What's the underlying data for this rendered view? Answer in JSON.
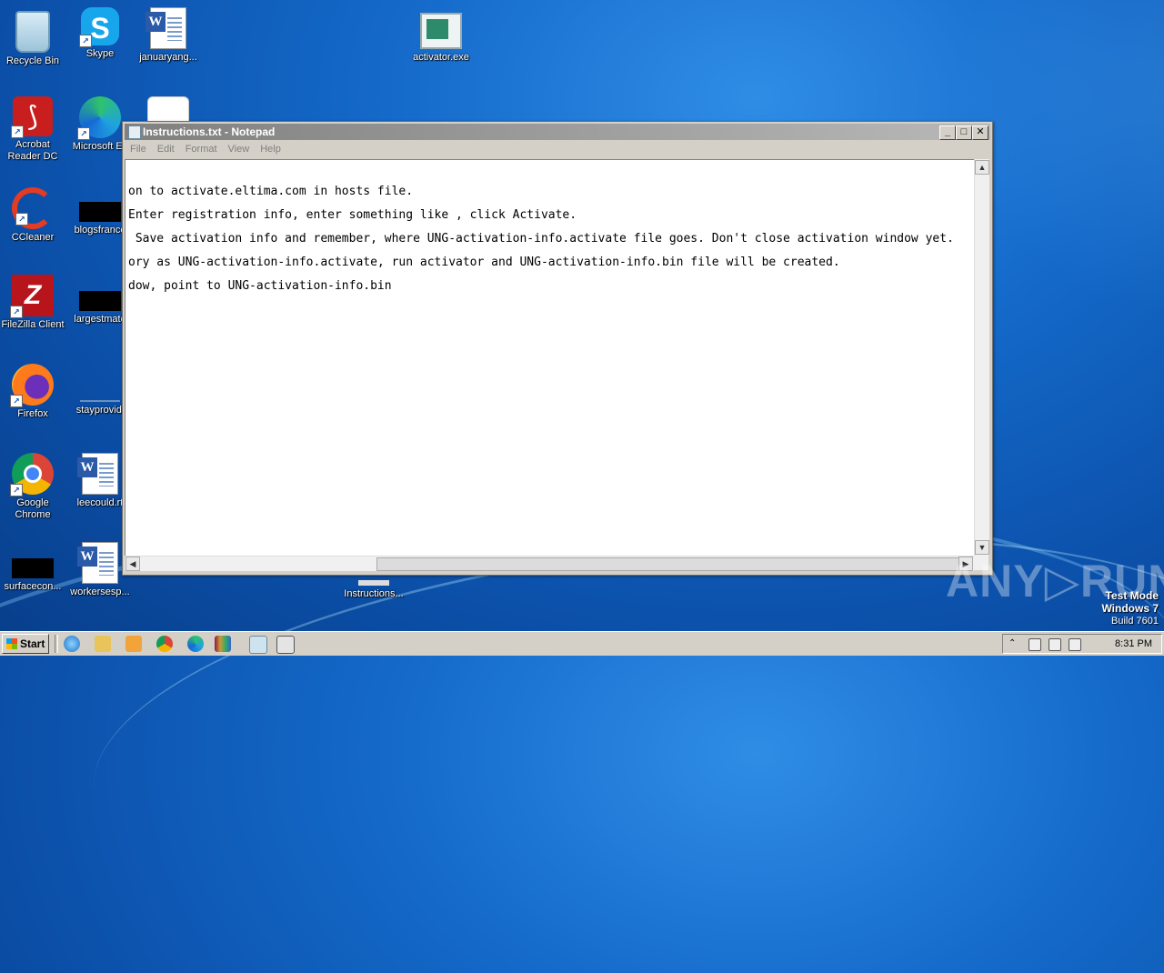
{
  "desktop": {
    "icons": [
      {
        "label": "Recycle Bin"
      },
      {
        "label": "Skype"
      },
      {
        "label": "januaryang..."
      },
      {
        "label": "activator.exe"
      },
      {
        "label": "Acrobat Reader DC"
      },
      {
        "label": "Microsoft Ec"
      },
      {
        "label": "CCleaner"
      },
      {
        "label": "blogsfrance"
      },
      {
        "label": "FileZilla Client"
      },
      {
        "label": "largestmato"
      },
      {
        "label": "Firefox"
      },
      {
        "label": "stayprovidi"
      },
      {
        "label": "Google Chrome"
      },
      {
        "label": "leecould.rt"
      },
      {
        "label": "surfacecon..."
      },
      {
        "label": "workersesp..."
      },
      {
        "label": "Instructions..."
      }
    ]
  },
  "notepad": {
    "title": "Instructions.txt - Notepad",
    "menu": [
      "File",
      "Edit",
      "Format",
      "View",
      "Help"
    ],
    "content": "on to activate.eltima.com in hosts file.\nEnter registration info, enter something like , click Activate.\n Save activation info and remember, where UNG-activation-info.activate file goes. Don't close activation window yet.\nory as UNG-activation-info.activate, run activator and UNG-activation-info.bin file will be created.\ndow, point to UNG-activation-info.bin"
  },
  "watermark": {
    "brand": "ANY▷RUN",
    "line1": "Test Mode",
    "line2": "Windows 7",
    "line3": "Build 7601"
  },
  "taskbar": {
    "start_label": "Start",
    "clock": "8:31 PM"
  }
}
